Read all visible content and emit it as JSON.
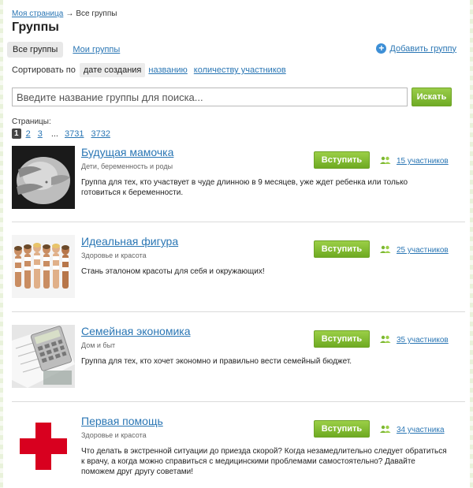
{
  "breadcrumb": {
    "home": "Моя страница",
    "arrow": "→",
    "current": "Все группы"
  },
  "page_title": "Группы",
  "tabs": [
    {
      "label": "Все группы",
      "active": true
    },
    {
      "label": "Мои группы",
      "active": false
    }
  ],
  "add_group": {
    "label": "Добавить группу",
    "icon": "plus-circle-icon"
  },
  "sort": {
    "label": "Сортировать по",
    "options": [
      {
        "label": "дате создания",
        "active": true
      },
      {
        "label": "названию",
        "active": false
      },
      {
        "label": "количеству участников",
        "active": false
      }
    ]
  },
  "search": {
    "placeholder": "Введите название группы для поиска...",
    "button": "Искать"
  },
  "pagination": {
    "label": "Страницы:",
    "current": "1",
    "pages": [
      "2",
      "3"
    ],
    "dots": "...",
    "last_pages": [
      "3731",
      "3732"
    ]
  },
  "groups": [
    {
      "title": "Будущая мамочка",
      "category": "Дети, беременность и роды",
      "description": "Группа для тех, кто участвует в чуде длинною в 9 месяцев, уже ждет ребенка или только готовиться к беременности.",
      "join": "Вступить",
      "members": "15 участников",
      "thumb": "pregnancy-photo"
    },
    {
      "title": "Идеальная фигура",
      "category": "Здоровье и красота",
      "description": "Стань эталоном красоты для себя и окружающих!",
      "join": "Вступить",
      "members": "25 участников",
      "thumb": "models-photo"
    },
    {
      "title": "Семейная экономика",
      "category": "Дом и быт",
      "description": "Группа для тех, кто хочет экономно и правильно вести семейный бюджет.",
      "join": "Вступить",
      "members": "35 участников",
      "thumb": "calculator-photo"
    },
    {
      "title": "Первая помощь",
      "category": "Здоровье и красота",
      "description": "Что делать в экстренной ситуации до приезда скорой? Когда незамедлительно следует обратиться к врачу, а когда можно справиться с медицинскими проблемами самостоятельно? Давайте поможем друг другу советами!",
      "join": "Вступить",
      "members": "34 участника",
      "thumb": "red-cross"
    }
  ],
  "colors": {
    "link": "#2a76b4",
    "button_green": "#7cb732",
    "red_cross": "#d8001f"
  }
}
